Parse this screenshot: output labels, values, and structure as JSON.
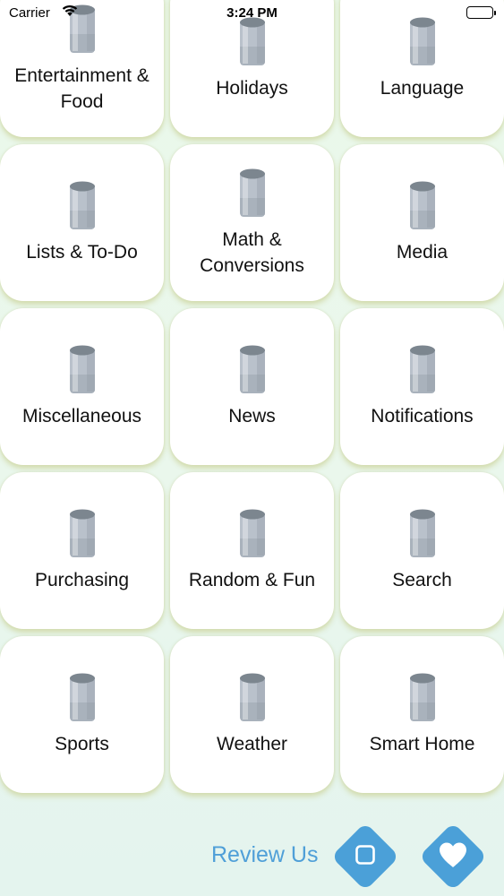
{
  "status_bar": {
    "carrier": "Carrier",
    "time": "3:24 PM",
    "wifi_icon": "wifi-icon",
    "battery_icon": "battery-icon"
  },
  "colors": {
    "accent": "#4ba0d8",
    "review_text": "#4f9fd8",
    "tile_bg": "#ffffff",
    "page_bg": "#eaf8ea",
    "speaker_body": "#b9c1cb",
    "speaker_top": "#7c868f"
  },
  "categories": [
    {
      "label_lines": [
        "Entertainment &",
        "Food"
      ],
      "icon": "smart-speaker-icon"
    },
    {
      "label_lines": [
        "Holidays"
      ],
      "icon": "smart-speaker-icon"
    },
    {
      "label_lines": [
        "Language"
      ],
      "icon": "smart-speaker-icon"
    },
    {
      "label_lines": [
        "Lists & To-Do"
      ],
      "icon": "smart-speaker-icon"
    },
    {
      "label_lines": [
        "Math &",
        "Conversions"
      ],
      "icon": "smart-speaker-icon"
    },
    {
      "label_lines": [
        "Media"
      ],
      "icon": "smart-speaker-icon"
    },
    {
      "label_lines": [
        "Miscellaneous"
      ],
      "icon": "smart-speaker-icon"
    },
    {
      "label_lines": [
        "News"
      ],
      "icon": "smart-speaker-icon"
    },
    {
      "label_lines": [
        "Notifications"
      ],
      "icon": "smart-speaker-icon"
    },
    {
      "label_lines": [
        "Purchasing"
      ],
      "icon": "smart-speaker-icon"
    },
    {
      "label_lines": [
        "Random & Fun"
      ],
      "icon": "smart-speaker-icon"
    },
    {
      "label_lines": [
        "Search"
      ],
      "icon": "smart-speaker-icon"
    },
    {
      "label_lines": [
        "Sports"
      ],
      "icon": "smart-speaker-icon"
    },
    {
      "label_lines": [
        "Weather"
      ],
      "icon": "smart-speaker-icon"
    },
    {
      "label_lines": [
        "Smart Home"
      ],
      "icon": "smart-speaker-icon"
    }
  ],
  "footer": {
    "review_label": "Review Us",
    "stop_icon": "stop-square-icon",
    "favorite_icon": "heart-icon"
  }
}
